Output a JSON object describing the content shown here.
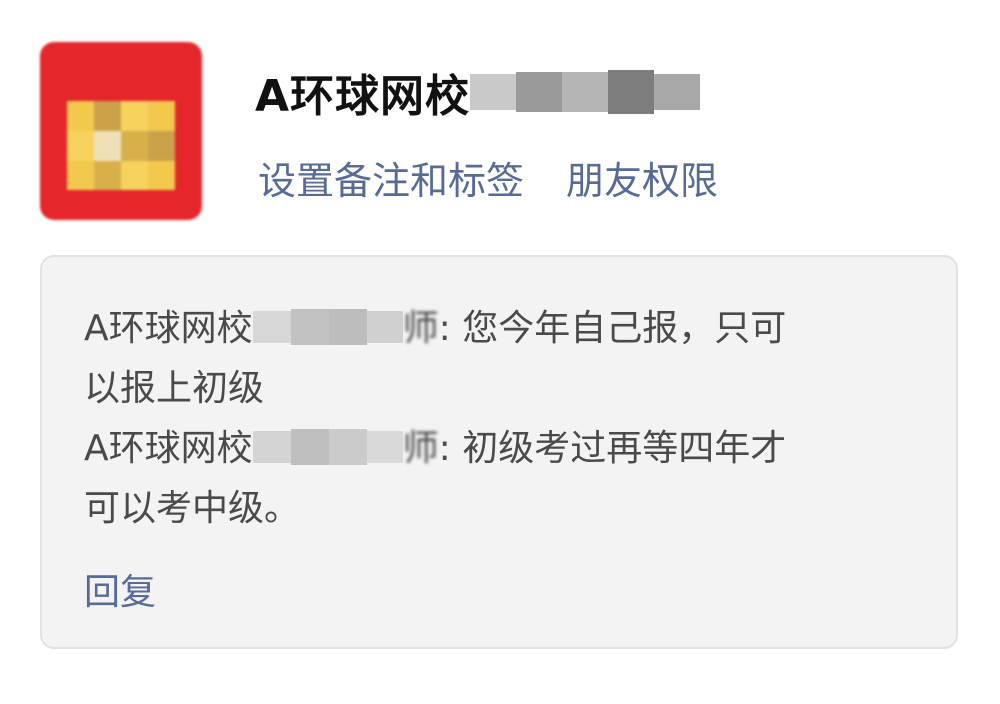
{
  "profile": {
    "name": "A环球网校",
    "avatar_colors": [
      "#e5262a",
      "#f2c94c",
      "#c9a24a",
      "#f6d35f",
      "#d8b04a",
      "#efe0b8"
    ]
  },
  "actions": {
    "remark_label": "设置备注和标签",
    "permission_label": "朋友权限"
  },
  "card": {
    "messages": [
      {
        "sender": "A环球网校",
        "sender_tail": "师",
        "line1": ": 您今年自己报，只可",
        "line2": "以报上初级"
      },
      {
        "sender": "A环球网校",
        "sender_tail": "师",
        "line1": ": 初级考过再等四年才",
        "line2": "可以考中级。"
      }
    ],
    "reply_label": "回复"
  },
  "colors": {
    "link": "#586b95",
    "card_bg": "#f3f3f4",
    "card_border": "#e2e2e4",
    "text": "#4a4a4a"
  }
}
